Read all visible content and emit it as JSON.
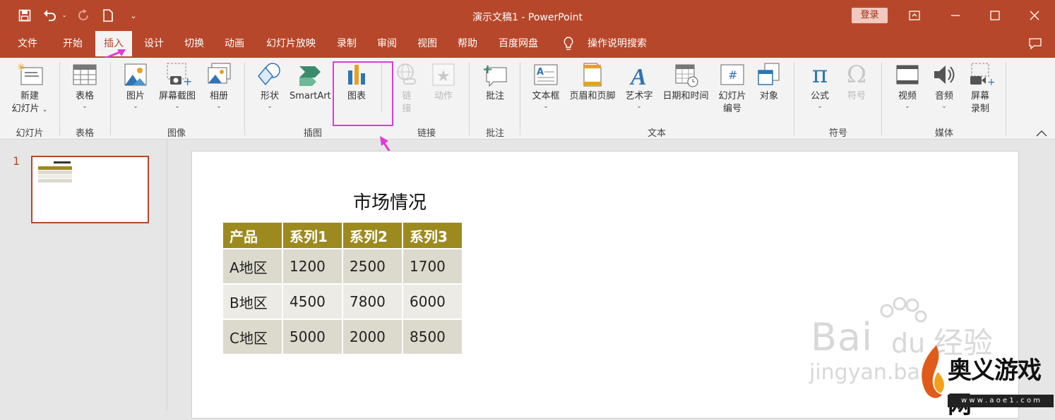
{
  "window": {
    "title": "演示文稿1  -  PowerPoint",
    "login_label": "登录"
  },
  "tabs": [
    "文件",
    "开始",
    "插入",
    "设计",
    "切换",
    "动画",
    "幻灯片放映",
    "录制",
    "审阅",
    "视图",
    "帮助",
    "百度网盘"
  ],
  "active_tab": "插入",
  "tell_me": "操作说明搜索",
  "ribbon": {
    "new_slide": "新建",
    "new_slide2": "幻灯片",
    "table": "表格",
    "picture": "图片",
    "screenshot": "屏幕截图",
    "album": "相册",
    "shapes": "形状",
    "smartart": "SmartArt",
    "chart": "图表",
    "link1": "链",
    "link2": "接",
    "action": "动作",
    "comment": "批注",
    "textbox": "文本框",
    "header_footer": "页眉和页脚",
    "wordart": "艺术字",
    "datetime": "日期和时间",
    "slide_num1": "幻灯片",
    "slide_num2": "编号",
    "object": "对象",
    "equation": "公式",
    "symbol": "符号",
    "video": "视频",
    "audio": "音频",
    "screen_rec1": "屏幕",
    "screen_rec2": "录制",
    "groups": {
      "slides": "幻灯片",
      "tables": "表格",
      "images": "图像",
      "illustrations": "插图",
      "links": "链接",
      "comments": "批注",
      "text": "文本",
      "symbols": "符号",
      "media": "媒体"
    }
  },
  "thumbnail": {
    "number": "1"
  },
  "slide": {
    "title": "市场情况",
    "table": {
      "headers": [
        "产品",
        "系列1",
        "系列2",
        "系列3"
      ],
      "rows": [
        [
          "A地区",
          "1200",
          "2500",
          "1700"
        ],
        [
          "B地区",
          "4500",
          "7800",
          "6000"
        ],
        [
          "C地区",
          "5000",
          "2000",
          "8500"
        ]
      ]
    }
  },
  "watermark": {
    "brand": "Bai",
    "paw": "du",
    "suffix": "经验",
    "url": "jingyan.ba"
  },
  "site_logo": {
    "text": "奥义游戏网",
    "url": "w w w . a o e 1 . c o m"
  }
}
